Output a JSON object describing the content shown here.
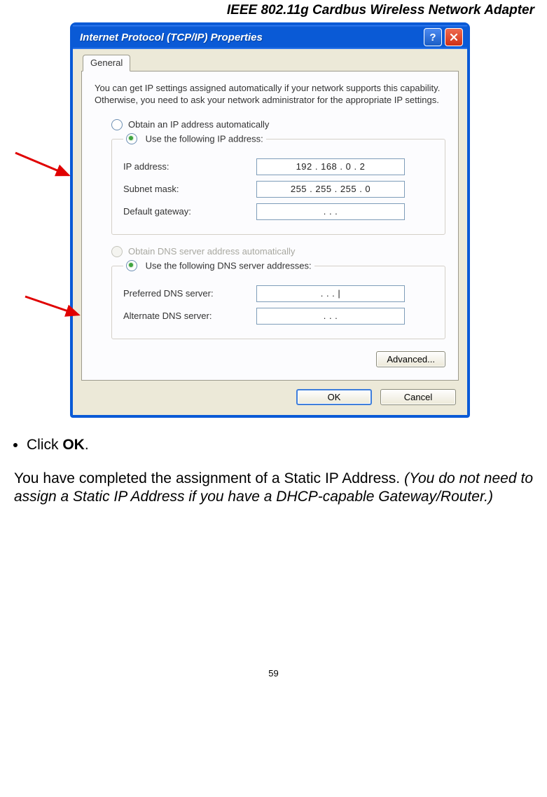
{
  "header": "IEEE 802.11g Cardbus Wireless Network Adapter",
  "dialog": {
    "title": "Internet Protocol (TCP/IP) Properties",
    "tab": "General",
    "description": "You can get IP settings assigned automatically if your network supports this capability. Otherwise, you need to ask your network administrator for the appropriate IP settings.",
    "radio_obtain_ip": "Obtain an IP address automatically",
    "radio_use_ip": "Use the following IP address:",
    "ip_label": "IP address:",
    "ip_value": "192 . 168 .   0  .   2",
    "subnet_label": "Subnet mask:",
    "subnet_value": "255 . 255 . 255 .   0",
    "gateway_label": "Default gateway:",
    "gateway_value": ".        .        .",
    "radio_obtain_dns": "Obtain DNS server address automatically",
    "radio_use_dns": "Use the following DNS server addresses:",
    "pref_dns_label": "Preferred DNS server:",
    "pref_dns_value": ".        .        .    |",
    "alt_dns_label": "Alternate DNS server:",
    "alt_dns_value": ".        .        .",
    "advanced_btn": "Advanced...",
    "ok_btn": "OK",
    "cancel_btn": "Cancel"
  },
  "instructions": {
    "bullet_prefix": "Click ",
    "bullet_bold": "OK",
    "bullet_suffix": ".",
    "para_plain": "You have completed the assignment of a Static IP Address. ",
    "para_italic": "(You do not need to assign a Static IP Address if you have a DHCP-capable Gateway/Router.)"
  },
  "page_number": "59"
}
